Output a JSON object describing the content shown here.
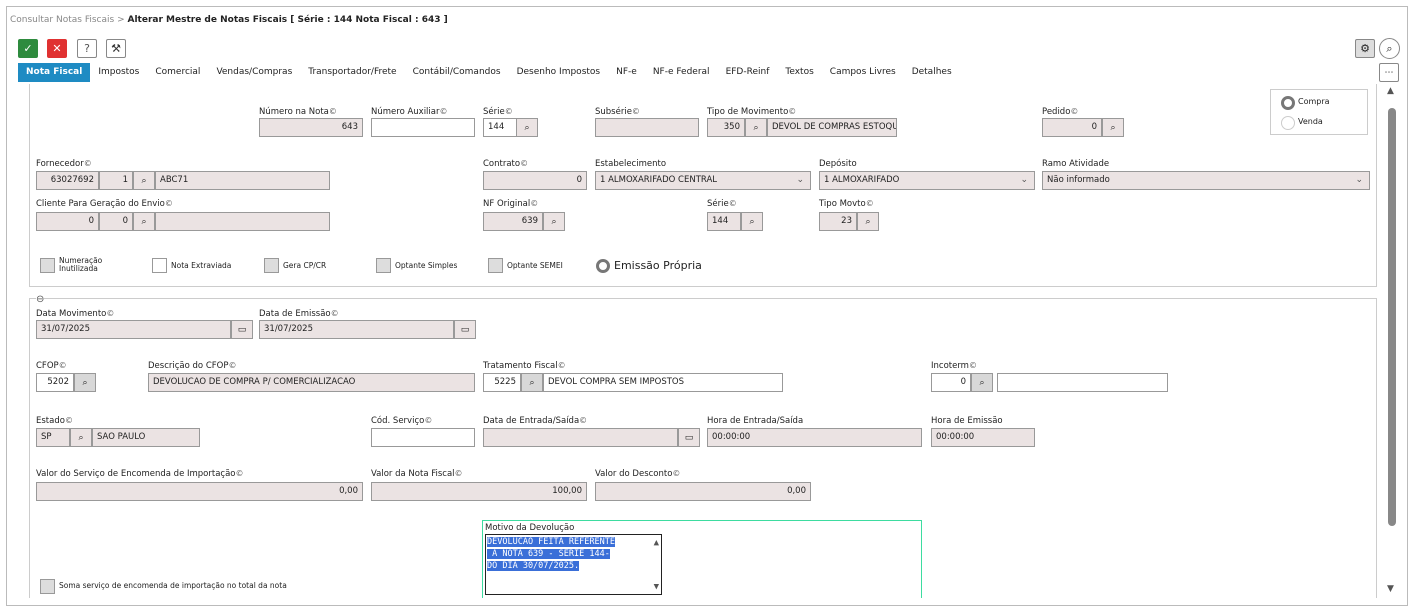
{
  "breadcrumb": {
    "parent": "Consultar Notas Fiscais",
    "sep": ">",
    "current": "Alterar Mestre de Notas Fiscais [ Série : 144 Nota Fiscal : 643 ]"
  },
  "toolbar": {
    "confirm_icon": "check-icon",
    "cancel_icon": "x-icon",
    "help_label": "?",
    "tools_icon": "wrench-icon",
    "confirm_color": "#2e8b3e",
    "cancel_color": "#e03131"
  },
  "tabs": [
    "Nota Fiscal",
    "Impostos",
    "Comercial",
    "Vendas/Compras",
    "Transportador/Frete",
    "Contábil/Comandos",
    "Desenho Impostos",
    "NF-e",
    "NF-e Federal",
    "EFD-Reinf",
    "Textos",
    "Campos Livres",
    "Detalhes"
  ],
  "accent": "#1e8bc3",
  "top": {
    "numero_nota": {
      "label": "Número na Nota",
      "value": "643"
    },
    "numero_aux": {
      "label": "Número Auxiliar",
      "value": ""
    },
    "serie": {
      "label": "Série",
      "value": "144"
    },
    "subserie": {
      "label": "Subsérie",
      "value": ""
    },
    "tipo_mov": {
      "label": "Tipo de Movimento",
      "code": "350",
      "desc": "DEVOL DE COMPRAS ESTOQUE"
    },
    "pedido": {
      "label": "Pedido",
      "value": "0"
    },
    "radio": {
      "compra": "Compra",
      "venda": "Venda"
    },
    "fornecedor": {
      "label": "Fornecedor",
      "code": "63027692",
      "seq": "1",
      "name": "ABC71"
    },
    "contrato": {
      "label": "Contrato",
      "value": "0"
    },
    "estabelecimento": {
      "label": "Estabelecimento",
      "value": "1 ALMOXARIFADO CENTRAL"
    },
    "deposito": {
      "label": "Depósito",
      "value": "1 ALMOXARIFADO"
    },
    "ramo": {
      "label": "Ramo Atividade",
      "value": "Não informado"
    },
    "cliente": {
      "label": "Cliente Para Geração do Envio",
      "code": "0",
      "seq": "0",
      "name": ""
    },
    "nf_original": {
      "label": "NF Original",
      "value": "639"
    },
    "serie2": {
      "label": "Série",
      "value": "144"
    },
    "tipo_movto": {
      "label": "Tipo Movto",
      "value": "23"
    },
    "checks": {
      "numeracao": "Numeração\nInutilizada",
      "extraviada": "Nota Extraviada",
      "gera": "Gera CP/CR",
      "simples": "Optante Simples",
      "semei": "Optante SEMEI"
    },
    "emissao": "Emissão Própria"
  },
  "bottom": {
    "data_mov": {
      "label": "Data Movimento",
      "value": "31/07/2025"
    },
    "data_emissao": {
      "label": "Data de Emissão",
      "value": "31/07/2025"
    },
    "cfop": {
      "label": "CFOP",
      "value": "5202"
    },
    "desc_cfop": {
      "label": "Descrição do CFOP",
      "value": "DEVOLUCAO DE COMPRA P/ COMERCIALIZACAO"
    },
    "tratamento": {
      "label": "Tratamento Fiscal",
      "code": "5225",
      "desc": "DEVOL COMPRA SEM IMPOSTOS"
    },
    "incoterm": {
      "label": "Incoterm",
      "value": "0"
    },
    "estado": {
      "label": "Estado",
      "code": "SP",
      "name": "SAO PAULO"
    },
    "cod_servico": {
      "label": "Cód. Serviço",
      "value": ""
    },
    "data_entrada": {
      "label": "Data de Entrada/Saída",
      "value": ""
    },
    "hora_entrada": {
      "label": "Hora de Entrada/Saída",
      "value": "00:00:00"
    },
    "hora_emissao": {
      "label": "Hora de Emissão",
      "value": "00:00:00"
    },
    "valor_servico": {
      "label": "Valor do Serviço de Encomenda de Importação",
      "value": "0,00"
    },
    "valor_nota": {
      "label": "Valor da Nota Fiscal",
      "value": "100,00"
    },
    "valor_desconto": {
      "label": "Valor do Desconto",
      "value": "0,00"
    },
    "motivo": {
      "label": "Motivo da Devolução",
      "line1": "DEVOLUCAO FEITA REFERENTE",
      "line2": " A NOTA 639 - SERIE 144-",
      "line3": "DO DIA 30/07/2025."
    },
    "soma": "Soma serviço de encomenda de importação no total da nota"
  }
}
